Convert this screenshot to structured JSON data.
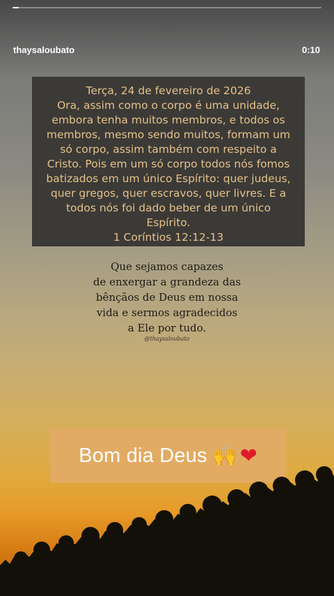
{
  "story": {
    "username": "thaysaloubato",
    "timer": "0:10",
    "progress": 0.02
  },
  "verse_card": {
    "lines": [
      "Terça, 24 de fevereiro de 2026",
      "Ora, assim como o corpo é uma unidade,",
      "embora tenha muitos membros, e todos os",
      "membros, mesmo sendo muitos, formam um",
      "só corpo, assim também com respeito a",
      "Cristo. Pois em um só corpo todos nós fomos",
      "batizados em um único Espírito: quer judeus,",
      "quer gregos, quer escravos, quer livres. E a",
      "todos nós foi dado beber de um único",
      "Espírito.",
      "1 Coríntios 12:12-13"
    ]
  },
  "quote": {
    "lines": [
      "Que sejamos capazes",
      "de enxergar a grandeza das",
      "bênçãos de Deus em nossa",
      "vida e sermos agradecidos",
      "a Ele por tudo."
    ],
    "handle": "@thaysaloubato"
  },
  "sticker": {
    "text": "Bom dia Deus",
    "emoji_icons": [
      "raising-hands-icon",
      "red-heart-icon"
    ]
  },
  "colors": {
    "verse_text": "#e5c18a",
    "verse_bg": "#3c3a37",
    "sticker_bg": "#e3aa69"
  }
}
